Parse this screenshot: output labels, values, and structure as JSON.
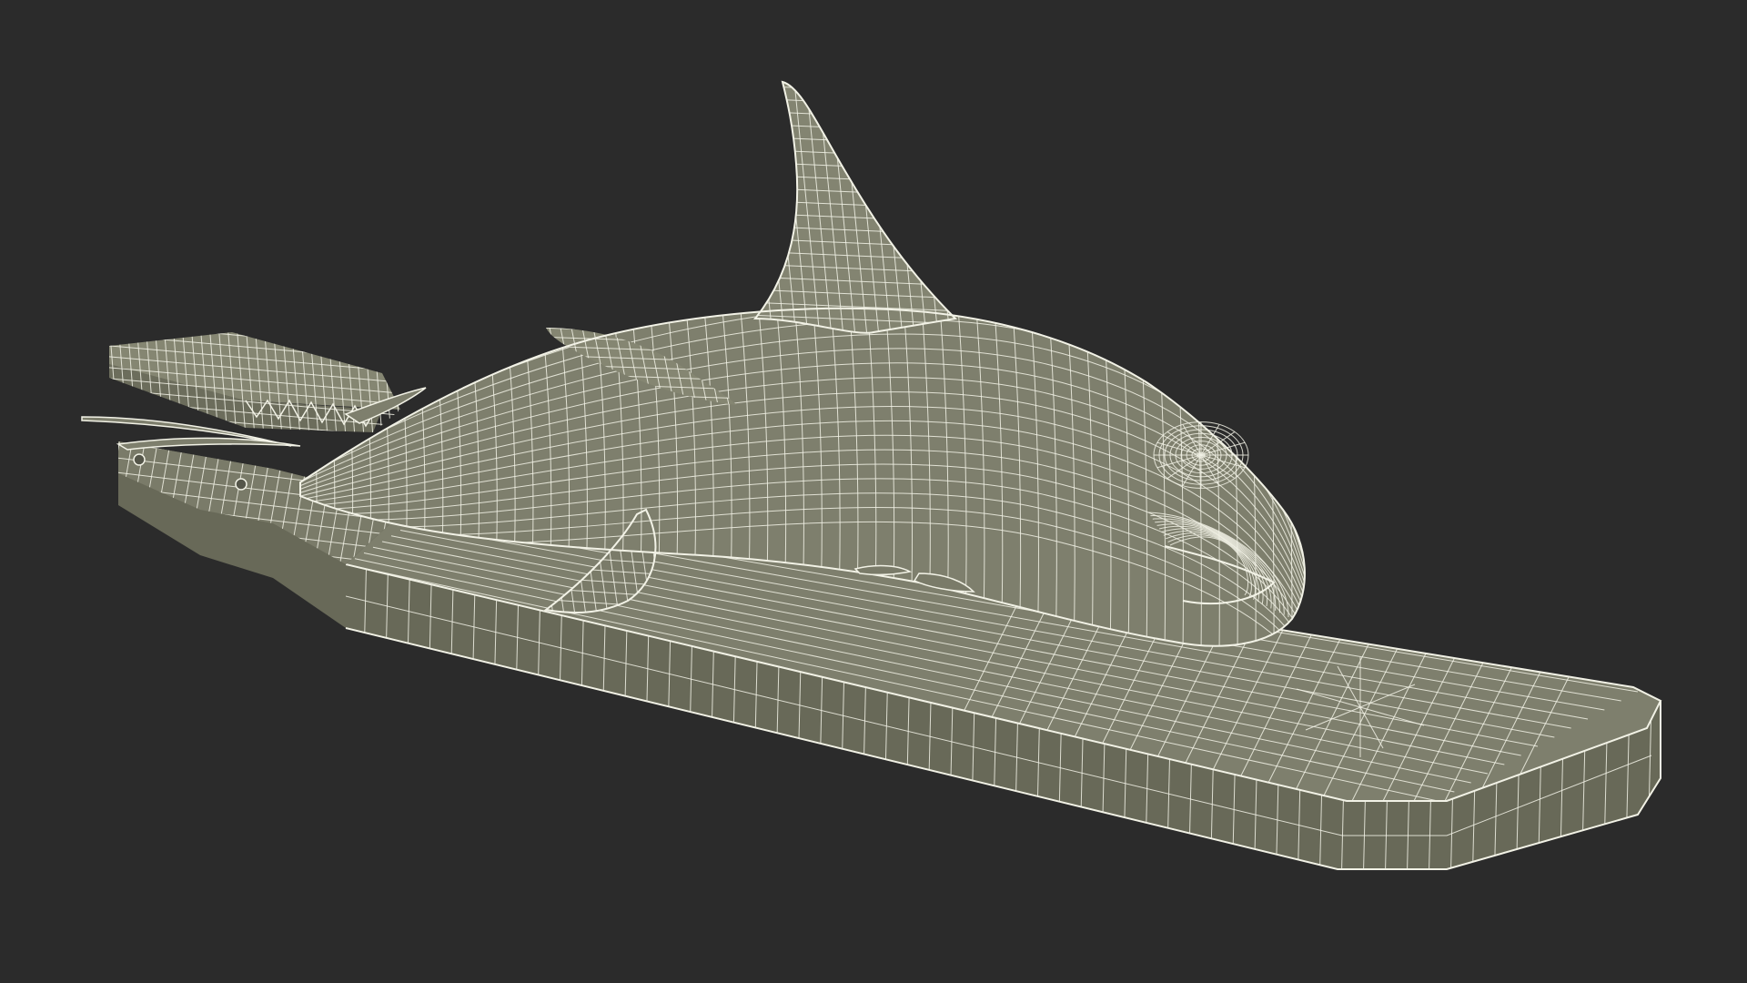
{
  "scene": {
    "background_color": "#2b2b2b",
    "surface_color": "#7e7f6d",
    "surface_dark_color": "#686958",
    "surface_light_color": "#93947f",
    "wire_color": "#f2f2e6",
    "subject": "wireframe-shark-on-board-render"
  }
}
